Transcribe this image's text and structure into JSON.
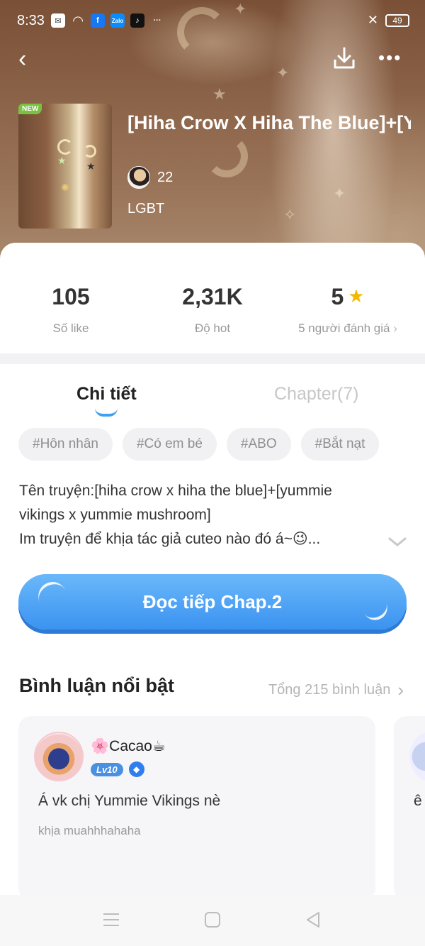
{
  "status_bar": {
    "time": "8:33",
    "battery": "49"
  },
  "book": {
    "badge": "NEW",
    "title": "[Hiha Crow X Hiha The Blue]+[Yummie Vikings X",
    "author_count": "22",
    "genre": "LGBT"
  },
  "stats": {
    "likes_value": "105",
    "likes_label": "Số like",
    "hot_value": "2,31K",
    "hot_label": "Độ hot",
    "rating_value": "5",
    "rating_label": "5 người đánh giá"
  },
  "tabs": {
    "detail": "Chi tiết",
    "chapters": "Chapter(7)"
  },
  "tags": [
    "#Hôn nhân",
    "#Có em bé",
    "#ABO",
    "#Bắt nạt"
  ],
  "description": {
    "line1": "Tên truyện:[hiha crow x hiha the blue]+[yummie",
    "line2": "vikings x yummie mushroom]",
    "line3": "Im truyện để khịa tác giả cuteo nào đó á~😉..."
  },
  "read_button": "Đọc tiếp Chap.2",
  "comments": {
    "section_title": "Bình luận nổi bật",
    "total": "Tổng 215 bình luận",
    "items": [
      {
        "name": "🌸Cacao☕",
        "level": "Lv10",
        "text": "Á vk chị Yummie Vikings nè",
        "subtext": "khịa muahhhahaha"
      },
      {
        "text": "ê"
      }
    ]
  },
  "icons": {
    "back": "chevron-left",
    "download": "download",
    "more": "more-horizontal",
    "star": "star",
    "chevron_down": "chevron-down"
  },
  "colors": {
    "accent": "#3b93f0",
    "star": "#f5b800",
    "new_badge": "#7bc043"
  }
}
